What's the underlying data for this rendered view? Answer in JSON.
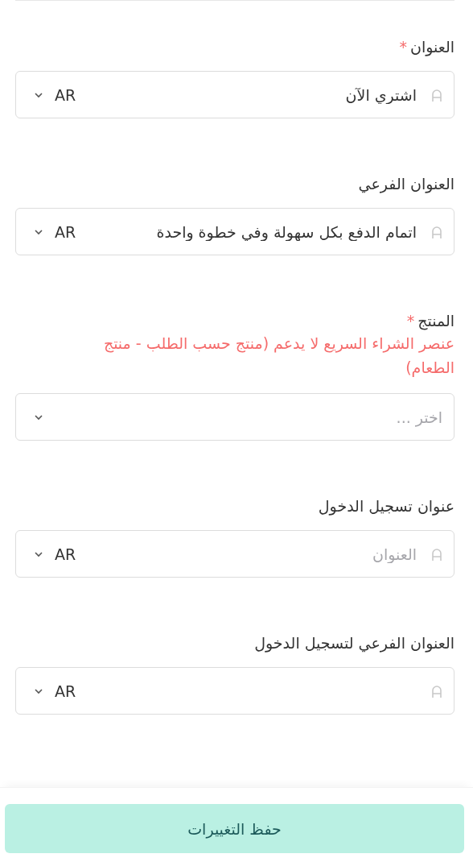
{
  "fields": [
    {
      "kind": "translatable",
      "label": "العنوان",
      "required_mark": "*",
      "value": "اشتري الآن",
      "language": "AR"
    },
    {
      "kind": "translatable",
      "label": "العنوان الفرعي",
      "value": "اتمام الدفع بكل سهولة وفي خطوة واحدة",
      "language": "AR"
    },
    {
      "kind": "select",
      "label": "المنتج",
      "required_mark": "*",
      "error": "عنصر الشراء السريع لا يدعم (منتج حسب الطلب - منتج الطعام)",
      "placeholder": "اختر ..."
    },
    {
      "kind": "translatable",
      "label": "عنوان تسجيل الدخول",
      "placeholder": "العنوان",
      "language": "AR"
    },
    {
      "kind": "translatable",
      "label": "العنوان الفرعي لتسجيل الدخول",
      "language": "AR"
    }
  ],
  "save_button": "حفظ التغييرات"
}
